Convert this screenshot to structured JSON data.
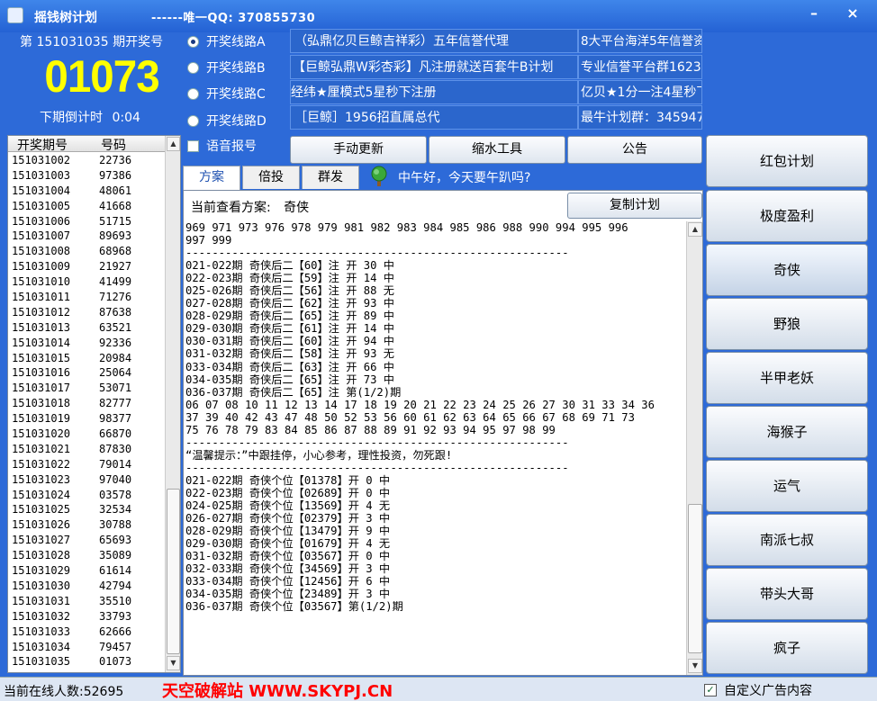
{
  "title": "摇钱树计划",
  "qq_banner": "------唯一QQ: 370855730",
  "window_buttons": {
    "minimize": "–",
    "close": "×"
  },
  "info": {
    "issue_prefix": "第",
    "issue_number": "151031035",
    "issue_suffix": "期开奖号",
    "winning_number": "01073",
    "countdown_label": "下期倒计时",
    "countdown_value": "0:04"
  },
  "routes": [
    {
      "label": "开奖线路A",
      "selected": true
    },
    {
      "label": "开奖线路B",
      "selected": false
    },
    {
      "label": "开奖线路C",
      "selected": false
    },
    {
      "label": "开奖线路D",
      "selected": false
    }
  ],
  "voice_label": "语音报号",
  "ads": [
    "（弘鼎亿贝巨鲸吉祥彩）五年信誉代理",
    "8大平台海洋5年信誉资金理赔团队网址",
    "【巨鲸弘鼎W彩杏彩】凡注册就送百套牛B计划",
    "专业信誉平台群162365924",
    "经纬★厘模式5星秒下注册",
    "亿贝★1分一注4星秒下注册",
    "［巨鲸］1956招直属总代",
    "最牛计划群：345947959"
  ],
  "toolbar": {
    "refresh": "手动更新",
    "shrink": "缩水工具",
    "notice": "公告"
  },
  "list": {
    "headers": [
      "开奖期号",
      "号码"
    ],
    "rows": [
      [
        "151031002",
        "22736"
      ],
      [
        "151031003",
        "97386"
      ],
      [
        "151031004",
        "48061"
      ],
      [
        "151031005",
        "41668"
      ],
      [
        "151031006",
        "51715"
      ],
      [
        "151031007",
        "89693"
      ],
      [
        "151031008",
        "68968"
      ],
      [
        "151031009",
        "21927"
      ],
      [
        "151031010",
        "41499"
      ],
      [
        "151031011",
        "71276"
      ],
      [
        "151031012",
        "87638"
      ],
      [
        "151031013",
        "63521"
      ],
      [
        "151031014",
        "92336"
      ],
      [
        "151031015",
        "20984"
      ],
      [
        "151031016",
        "25064"
      ],
      [
        "151031017",
        "53071"
      ],
      [
        "151031018",
        "82777"
      ],
      [
        "151031019",
        "98377"
      ],
      [
        "151031020",
        "66870"
      ],
      [
        "151031021",
        "87830"
      ],
      [
        "151031022",
        "79014"
      ],
      [
        "151031023",
        "97040"
      ],
      [
        "151031024",
        "03578"
      ],
      [
        "151031025",
        "32534"
      ],
      [
        "151031026",
        "30788"
      ],
      [
        "151031027",
        "65693"
      ],
      [
        "151031028",
        "35089"
      ],
      [
        "151031029",
        "61614"
      ],
      [
        "151031030",
        "42794"
      ],
      [
        "151031031",
        "35510"
      ],
      [
        "151031032",
        "33793"
      ],
      [
        "151031033",
        "62666"
      ],
      [
        "151031034",
        "79457"
      ],
      [
        "151031035",
        "01073"
      ]
    ]
  },
  "tabs": [
    "方案",
    "倍投",
    "群发"
  ],
  "greeting": "中午好，今天要午趴吗?",
  "plan": {
    "label": "当前查看方案:",
    "name": "奇侠",
    "copy_label": "复制计划",
    "lines": [
      "969 971 973 976 978 979 981 982 983 984 985 986 988 990 994 995 996",
      "997 999",
      "----------------------------------------------------------",
      "021-022期 奇侠后二【60】注 开 30 中",
      "022-023期 奇侠后二【59】注 开 14 中",
      "025-026期 奇侠后二【56】注 开 88 无",
      "027-028期 奇侠后二【62】注 开 93 中",
      "028-029期 奇侠后二【65】注 开 89 中",
      "029-030期 奇侠后二【61】注 开 14 中",
      "030-031期 奇侠后二【60】注 开 94 中",
      "031-032期 奇侠后二【58】注 开 93 无",
      "033-034期 奇侠后二【63】注 开 66 中",
      "034-035期 奇侠后二【65】注 开 73 中",
      "036-037期 奇侠后二【65】注 第(1/2)期",
      "06 07 08 10 11 12 13 14 17 18 19 20 21 22 23 24 25 26 27 30 31 33 34 36",
      "37 39 40 42 43 47 48 50 52 53 56 60 61 62 63 64 65 66 67 68 69 71 73",
      "75 76 78 79 83 84 85 86 87 88 89 91 92 93 94 95 97 98 99",
      "----------------------------------------------------------",
      "“温馨提示：”中跟挂停，小心参考，理性投资，勿死跟!",
      "----------------------------------------------------------",
      "021-022期 奇侠个位【01378】开 0 中",
      "022-023期 奇侠个位【02689】开 0 中",
      "024-025期 奇侠个位【13569】开 4 无",
      "026-027期 奇侠个位【02379】开 3 中",
      "028-029期 奇侠个位【13479】开 9 中",
      "029-030期 奇侠个位【01679】开 4 无",
      "031-032期 奇侠个位【03567】开 0 中",
      "032-033期 奇侠个位【34569】开 3 中",
      "033-034期 奇侠个位【12456】开 6 中",
      "034-035期 奇侠个位【23489】开 3 中",
      "036-037期 奇侠个位【03567】第(1/2)期"
    ]
  },
  "plans": [
    "红包计划",
    "极度盈利",
    "奇侠",
    "野狼",
    "半甲老妖",
    "海猴子",
    "运气",
    "南派七叔",
    "带头大哥",
    "疯子"
  ],
  "status": {
    "online": "当前在线人数:52695",
    "watermark": "天空破解站 WWW.SKYPJ.CN",
    "custom_ad": "自定义广告内容",
    "custom_checked": "✓"
  }
}
